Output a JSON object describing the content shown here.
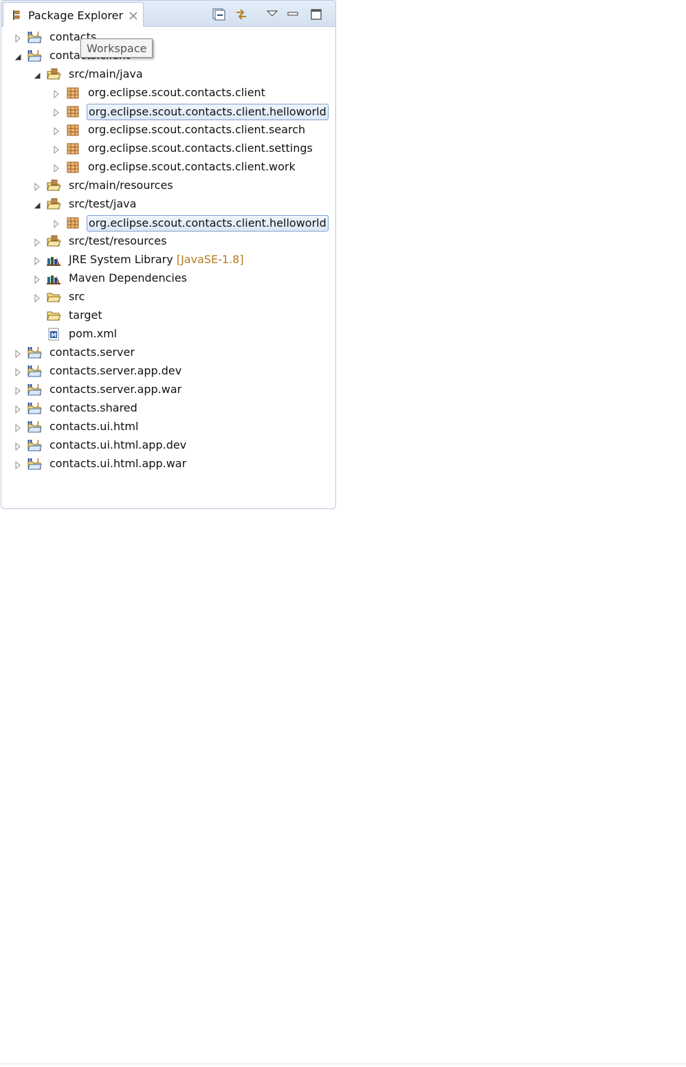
{
  "view": {
    "title": "Package Explorer",
    "tooltip": "Workspace",
    "toolbar": [
      "collapse-all-icon",
      "link-with-editor-icon",
      "view-menu-icon",
      "minimize-icon",
      "maximize-icon"
    ]
  },
  "tree": [
    {
      "label": "contacts",
      "depth": 0,
      "icon": "maven-project",
      "twisty": "collapsed"
    },
    {
      "label": "contacts.client",
      "depth": 0,
      "icon": "maven-project",
      "twisty": "expanded"
    },
    {
      "label": "src/main/java",
      "depth": 1,
      "icon": "source-folder",
      "twisty": "expanded"
    },
    {
      "label": "org.eclipse.scout.contacts.client",
      "depth": 2,
      "icon": "package",
      "twisty": "collapsed"
    },
    {
      "label": "org.eclipse.scout.contacts.client.helloworld",
      "depth": 2,
      "icon": "package",
      "twisty": "collapsed",
      "selected": true
    },
    {
      "label": "org.eclipse.scout.contacts.client.search",
      "depth": 2,
      "icon": "package",
      "twisty": "collapsed"
    },
    {
      "label": "org.eclipse.scout.contacts.client.settings",
      "depth": 2,
      "icon": "package",
      "twisty": "collapsed"
    },
    {
      "label": "org.eclipse.scout.contacts.client.work",
      "depth": 2,
      "icon": "package",
      "twisty": "collapsed"
    },
    {
      "label": "src/main/resources",
      "depth": 1,
      "icon": "source-folder",
      "twisty": "collapsed"
    },
    {
      "label": "src/test/java",
      "depth": 1,
      "icon": "source-folder",
      "twisty": "expanded"
    },
    {
      "label": "org.eclipse.scout.contacts.client.helloworld",
      "depth": 2,
      "icon": "package",
      "twisty": "collapsed",
      "selected": true
    },
    {
      "label": "src/test/resources",
      "depth": 1,
      "icon": "source-folder",
      "twisty": "collapsed"
    },
    {
      "label": "JRE System Library",
      "decoration": "[JavaSE-1.8]",
      "depth": 1,
      "icon": "library",
      "twisty": "collapsed"
    },
    {
      "label": "Maven Dependencies",
      "depth": 1,
      "icon": "library",
      "twisty": "collapsed"
    },
    {
      "label": "src",
      "depth": 1,
      "icon": "folder",
      "twisty": "collapsed"
    },
    {
      "label": "target",
      "depth": 1,
      "icon": "folder",
      "twisty": "none"
    },
    {
      "label": "pom.xml",
      "depth": 1,
      "icon": "pom-file",
      "twisty": "none"
    },
    {
      "label": "contacts.server",
      "depth": 0,
      "icon": "maven-project",
      "twisty": "collapsed"
    },
    {
      "label": "contacts.server.app.dev",
      "depth": 0,
      "icon": "maven-project",
      "twisty": "collapsed"
    },
    {
      "label": "contacts.server.app.war",
      "depth": 0,
      "icon": "maven-project",
      "twisty": "collapsed"
    },
    {
      "label": "contacts.shared",
      "depth": 0,
      "icon": "maven-project",
      "twisty": "collapsed"
    },
    {
      "label": "contacts.ui.html",
      "depth": 0,
      "icon": "maven-project",
      "twisty": "collapsed"
    },
    {
      "label": "contacts.ui.html.app.dev",
      "depth": 0,
      "icon": "maven-project",
      "twisty": "collapsed"
    },
    {
      "label": "contacts.ui.html.app.war",
      "depth": 0,
      "icon": "maven-project",
      "twisty": "collapsed"
    }
  ],
  "colors": {
    "selection_border": "#7da2ce",
    "decoration": "#b57a1e",
    "package": "#b06a2a"
  }
}
